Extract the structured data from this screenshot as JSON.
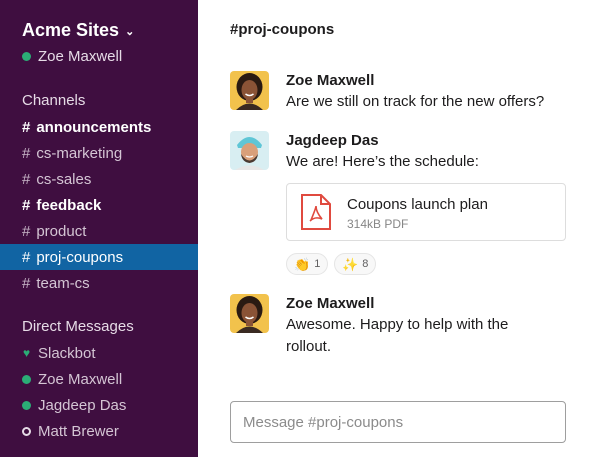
{
  "workspace": {
    "name": "Acme Sites",
    "current_user": "Zoe Maxwell",
    "current_user_status": "online"
  },
  "sidebar": {
    "channels_title": "Channels",
    "channels": [
      {
        "name": "announcements",
        "bold": true,
        "active": false
      },
      {
        "name": "cs-marketing",
        "bold": false,
        "active": false
      },
      {
        "name": "cs-sales",
        "bold": false,
        "active": false
      },
      {
        "name": "feedback",
        "bold": true,
        "active": false
      },
      {
        "name": "product",
        "bold": false,
        "active": false
      },
      {
        "name": "proj-coupons",
        "bold": false,
        "active": true
      },
      {
        "name": "team-cs",
        "bold": false,
        "active": false
      }
    ],
    "dm_title": "Direct Messages",
    "dms": [
      {
        "name": "Slackbot",
        "status_icon": "heart-icon"
      },
      {
        "name": "Zoe Maxwell",
        "status_icon": "online-dot"
      },
      {
        "name": "Jagdeep Das",
        "status_icon": "online-dot"
      },
      {
        "name": "Matt Brewer",
        "status_icon": "away-dot"
      }
    ],
    "hash": "#"
  },
  "channel": {
    "title": "#proj-coupons"
  },
  "messages": [
    {
      "author": "Zoe Maxwell",
      "text": "Are we still on track for the new offers?"
    },
    {
      "author": "Jagdeep Das",
      "text": "We are! Here’s the schedule:",
      "attachment": {
        "name": "Coupons launch plan",
        "meta": "314kB PDF",
        "icon": "pdf-file-icon"
      },
      "reactions": [
        {
          "emoji": "👏",
          "count": "1"
        },
        {
          "emoji": "✨",
          "count": "8"
        }
      ]
    },
    {
      "author": "Zoe Maxwell",
      "text": "Awesome. Happy to help with the rollout."
    }
  ],
  "composer": {
    "placeholder": "Message #proj-coupons"
  },
  "colors": {
    "sidebar_bg": "#3f0e40",
    "active_channel": "#1164a3",
    "online": "#2bac76",
    "pdf_red": "#e04a3f"
  }
}
